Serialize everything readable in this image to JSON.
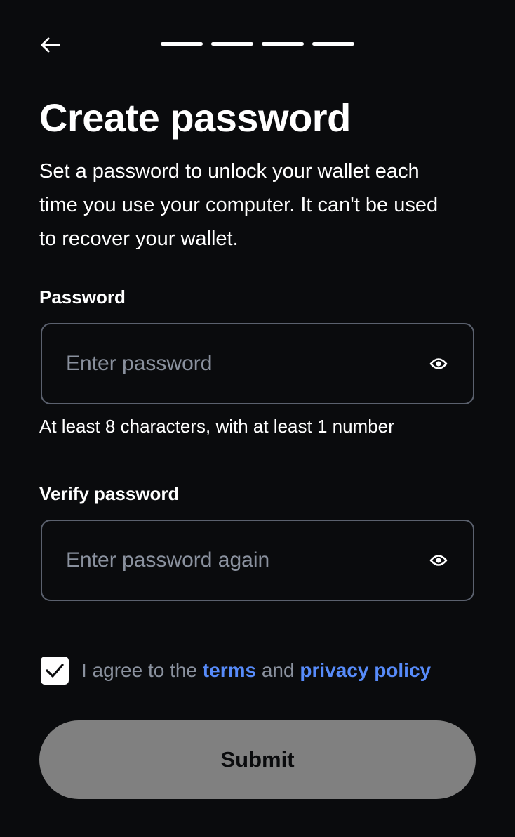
{
  "header": {
    "back_icon": "arrow-left-icon",
    "progress_steps": 4
  },
  "page": {
    "title": "Create password",
    "subtitle": "Set a password to unlock your wallet each time you use your computer. It can't be used to recover your wallet."
  },
  "password": {
    "label": "Password",
    "placeholder": "Enter password",
    "value": "",
    "eye_icon": "eye-icon",
    "hint": "At least 8 characters, with at least 1 number"
  },
  "verify": {
    "label": "Verify password",
    "placeholder": "Enter password again",
    "value": "",
    "eye_icon": "eye-icon"
  },
  "agree": {
    "checked": true,
    "prefix": "I agree to the ",
    "terms": "terms",
    "middle": " and ",
    "privacy": "privacy policy"
  },
  "submit": {
    "label": "Submit"
  },
  "colors": {
    "background": "#0a0b0d",
    "link": "#578bfa",
    "placeholder": "#8a919e",
    "border": "#5b616e",
    "button_disabled": "#808080"
  }
}
